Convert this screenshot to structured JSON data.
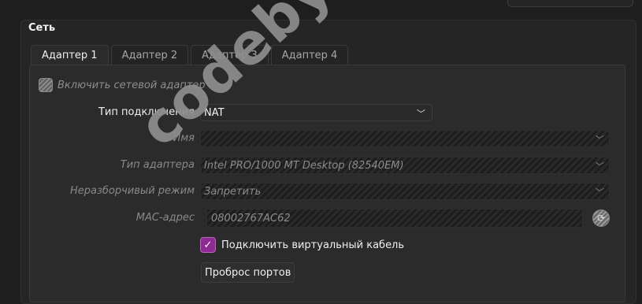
{
  "section_title": "Сеть",
  "tabs": [
    "Адаптер 1",
    "Адаптер 2",
    "Адаптер 3",
    "Адаптер 4"
  ],
  "active_tab": 0,
  "enable_adapter": {
    "label": "Включить сетевой адаптер",
    "checked": true,
    "enabled": false
  },
  "attached_to": {
    "label": "Тип подключения",
    "value": "NAT"
  },
  "name": {
    "label": "Имя",
    "value": ""
  },
  "adapter_type": {
    "label": "Тип адаптера",
    "value": "Intel PRO/1000 MT Desktop (82540EM)"
  },
  "promiscuous": {
    "label": "Неразборчивый режим",
    "value": "Запретить"
  },
  "mac": {
    "label": "MAC-адрес",
    "value": "08002767AC62"
  },
  "cable": {
    "label": "Подключить виртуальный кабель",
    "checked": true
  },
  "port_forwarding": {
    "label": "Проброс портов"
  },
  "watermark_text": "codeby.net",
  "colors": {
    "accent": "#8e2a93",
    "background": "#1e1e1e",
    "panel": "#2b2b2b"
  },
  "icons": {
    "dropdown": "chevron-down-icon",
    "refresh": "refresh-icon",
    "check": "checkmark-icon"
  }
}
